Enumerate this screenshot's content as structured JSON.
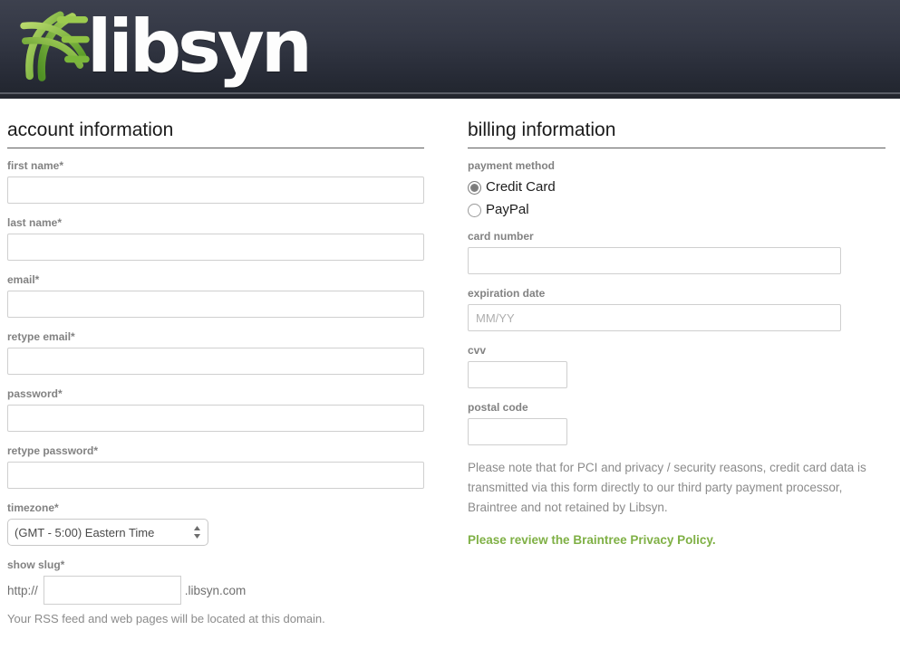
{
  "header": {
    "brand_name": "libsyn",
    "logo_icon": "libsyn-leaf-mark",
    "brand_green": "#8cc63f",
    "background_dark": "#2b2f3a"
  },
  "account": {
    "title": "account information",
    "fields": [
      {
        "label": "first name*",
        "value": "",
        "placeholder": ""
      },
      {
        "label": "last name*",
        "value": "",
        "placeholder": ""
      },
      {
        "label": "email*",
        "value": "",
        "placeholder": ""
      },
      {
        "label": "retype email*",
        "value": "",
        "placeholder": ""
      },
      {
        "label": "password*",
        "value": "",
        "placeholder": ""
      },
      {
        "label": "retype password*",
        "value": "",
        "placeholder": ""
      }
    ],
    "timezone": {
      "label": "timezone*",
      "selected": "(GMT - 5:00) Eastern Time",
      "options": [
        "(GMT - 5:00) Eastern Time"
      ]
    },
    "slug": {
      "label": "show slug*",
      "prefix": "http://",
      "suffix": ".libsyn.com",
      "value": "",
      "placeholder": "",
      "helper": "Your RSS feed and web pages will be located at this domain."
    }
  },
  "billing": {
    "title": "billing information",
    "payment_method": {
      "label": "payment method",
      "options": [
        {
          "label": "Credit Card",
          "selected": true
        },
        {
          "label": "PayPal",
          "selected": false
        }
      ]
    },
    "card_number": {
      "label": "card number",
      "value": "",
      "placeholder": ""
    },
    "expiration": {
      "label": "expiration date",
      "value": "",
      "placeholder": "MM/YY"
    },
    "cvv": {
      "label": "cvv",
      "value": "",
      "placeholder": ""
    },
    "postal_code": {
      "label": "postal code",
      "value": "",
      "placeholder": ""
    },
    "notice": "Please note that for PCI and privacy / security reasons, credit card data is transmitted via this form directly to our third party payment processor, Braintree and not retained by Libsyn.",
    "notice_link": "Please review the Braintree Privacy Policy.",
    "link_color": "#7fb045"
  }
}
